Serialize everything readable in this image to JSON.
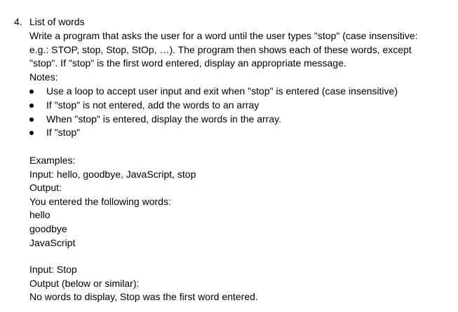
{
  "item": {
    "number": "4.",
    "title": "List of words"
  },
  "description": [
    "Write a program that asks the user for a word until the user types \"stop\" (case insensitive:",
    "e.g.: STOP, stop, Stop, StOp, …).  The program then shows each of these words, except",
    "\"stop\".  If \"stop\" is the first word entered, display an appropriate message."
  ],
  "notes_heading": "Notes:",
  "notes": [
    "Use a loop to accept user input and exit when \"stop\" is entered (case insensitive)",
    "If \"stop\" is not entered, add the words to an array",
    "When \"stop\" is entered, display the words in the array.",
    "If \"stop\""
  ],
  "examples_heading": "Examples:",
  "example1": {
    "input": "Input: hello, goodbye, JavaScript, stop",
    "output_label": "Output:",
    "output_lines": [
      "You entered the following words:",
      "hello",
      "goodbye",
      "JavaScript"
    ]
  },
  "example2": {
    "input": "Input: Stop",
    "output_label": "Output (below or similar):",
    "output_line": "No words to display, Stop was the first word entered."
  }
}
